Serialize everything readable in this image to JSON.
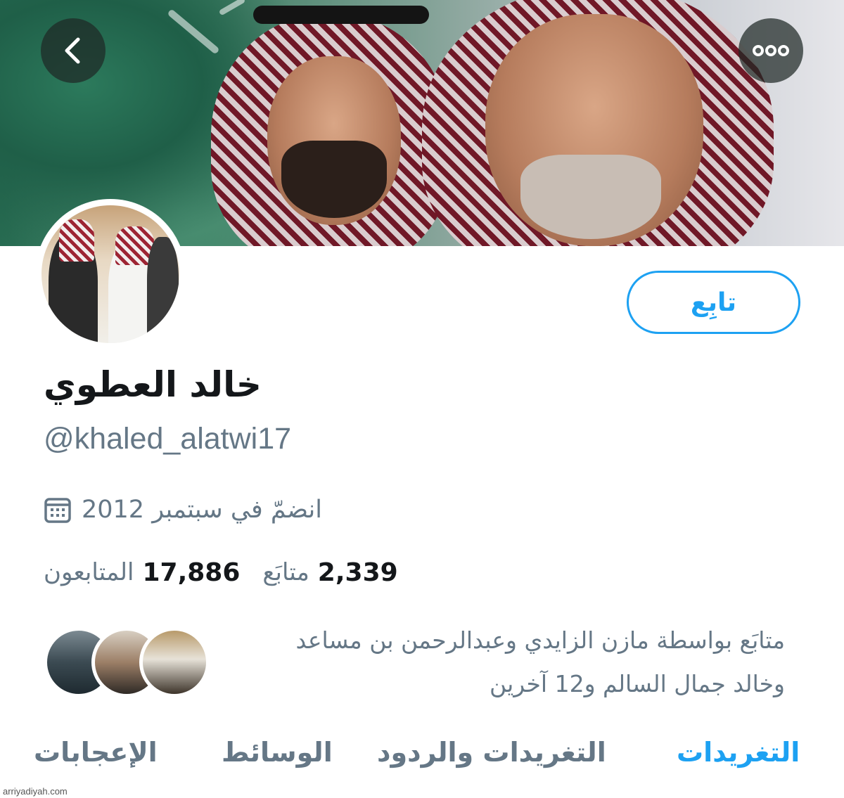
{
  "header": {
    "back_icon": "chevron-left-icon",
    "more_icon": "more-dots-icon"
  },
  "profile": {
    "follow_label": "تابِع",
    "display_name": "خالد العطوي",
    "handle": "@khaled_alatwi17",
    "joined": "انضمّ في سبتمبر 2012",
    "joined_icon": "calendar-icon",
    "following_count": "2,339",
    "following_label": "متابَع",
    "followers_count": "17,886",
    "followers_label": "المتابعون",
    "followed_by_line1": "متابَع بواسطة مازن الزايدي وعبدالرحمن بن مساعد",
    "followed_by_line2": "وخالد جمال السالم و12 آخرين"
  },
  "tabs": [
    {
      "label": "التغريدات",
      "active": true
    },
    {
      "label": "التغريدات والردود",
      "active": false
    },
    {
      "label": "الوسائط",
      "active": false
    },
    {
      "label": "الإعجابات",
      "active": false
    }
  ],
  "watermark": "arriyadiyah.com",
  "colors": {
    "accent": "#1da1f2",
    "secondary_text": "#657786",
    "primary_text": "#14171a"
  }
}
